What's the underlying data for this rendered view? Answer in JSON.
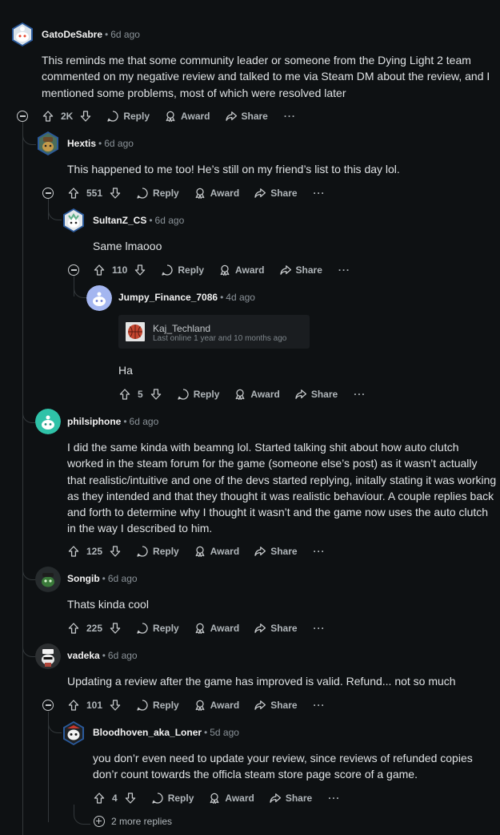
{
  "labels": {
    "reply": "Reply",
    "award": "Award",
    "share": "Share",
    "more": "···",
    "dot": "•"
  },
  "comments": [
    {
      "username": "GatoDeSabre",
      "time": "6d ago",
      "body": "This reminds me that some community leader or someone from the Dying Light 2 team commented on my negative review and talked to me via Steam DM about the review, and I mentioned some problems, most of which were resolved later",
      "votes": "2K"
    },
    {
      "username": "Hextis",
      "time": "6d ago",
      "body": "This happened to me too! He’s still on my friend’s list to this day lol.",
      "votes": "551"
    },
    {
      "username": "SultanZ_CS",
      "time": "6d ago",
      "body": "Same lmaooo",
      "votes": "110"
    },
    {
      "username": "Jumpy_Finance_7086",
      "time": "4d ago",
      "embed": {
        "name": "Kaj_Techland",
        "status": "Last online 1 year and 10 months ago"
      },
      "body": "Ha",
      "votes": "5"
    },
    {
      "username": "philsiphone",
      "time": "6d ago",
      "body": "I did the same kinda with beamng lol. Started talking shit about how auto clutch worked in the steam forum for the game (someone else’s post) as it wasn’t actually that realistic/intuitive and one of the devs started replying, initally stating it was working as they intended and that they thought it was realistic behaviour. A couple replies back and forth to determine why I thought it wasn’t and the game now uses the auto clutch in the way I described to him.",
      "votes": "125"
    },
    {
      "username": "Songib",
      "time": "6d ago",
      "body": "Thats kinda cool",
      "votes": "225"
    },
    {
      "username": "vadeka",
      "time": "6d ago",
      "body": "Updating a review after the game has improved is valid. Refund... not so much",
      "votes": "101"
    },
    {
      "username": "Bloodhoven_aka_Loner",
      "time": "5d ago",
      "body": "you don’r even need to update your review, since reviews of refunded copies don’r count towards the officla steam store page score of a game.",
      "votes": "4"
    }
  ],
  "more_replies": "2 more replies",
  "colors": {
    "background": "#0e1113",
    "text": "#d7dadc",
    "meta": "#8a9298",
    "thread_line": "#33383b",
    "embed_bg": "#1a1d20"
  }
}
